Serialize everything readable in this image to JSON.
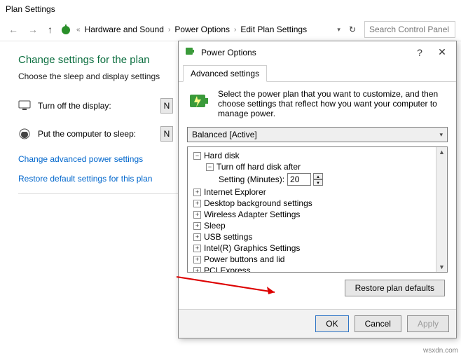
{
  "window": {
    "title": "Plan Settings"
  },
  "toolbar": {
    "back": "←",
    "fwd": "→",
    "up": "↑",
    "crumbs": [
      "Hardware and Sound",
      "Power Options",
      "Edit Plan Settings"
    ],
    "sep": "›",
    "pre": "«",
    "refresh": "↻",
    "search_placeholder": "Search Control Panel"
  },
  "main": {
    "heading": "Change settings for the plan",
    "subtext": "Choose the sleep and display settings",
    "display_label": "Turn off the display:",
    "sleep_label": "Put the computer to sleep:",
    "link_advanced": "Change advanced power settings",
    "link_restore": "Restore default settings for this plan",
    "dd": "N"
  },
  "dialog": {
    "title": "Power Options",
    "help": "?",
    "close": "✕",
    "tab": "Advanced settings",
    "desc": "Select the power plan that you want to customize, and then choose settings that reflect how you want your computer to manage power.",
    "plan": "Balanced [Active]",
    "tree": {
      "hard_disk": "Hard disk",
      "turn_off": "Turn off hard disk after",
      "setting_label": "Setting (Minutes):",
      "setting_value": "20",
      "ie": "Internet Explorer",
      "desktop": "Desktop background settings",
      "wifi": "Wireless Adapter Settings",
      "sleep": "Sleep",
      "usb": "USB settings",
      "intel": "Intel(R) Graphics Settings",
      "power_btn": "Power buttons and lid",
      "pci": "PCI Express"
    },
    "restore": "Restore plan defaults",
    "ok": "OK",
    "cancel": "Cancel",
    "apply": "Apply"
  },
  "watermark": "wsxdn.com"
}
